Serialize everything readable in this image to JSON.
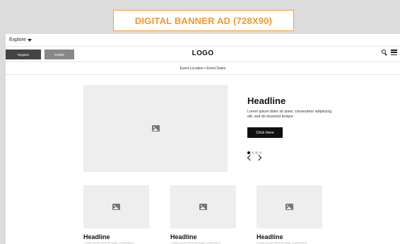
{
  "ad": {
    "label": "DIGITAL BANNER AD (728X90)"
  },
  "topbar": {
    "explore_label": "Explore"
  },
  "nav": {
    "register_label": "Register",
    "exhibit_label": "Exhibit",
    "logo_text": "LOGO"
  },
  "event_bar": {
    "text": "Event Location  •  Event Dates"
  },
  "hero": {
    "headline": "Headline",
    "body": "Lorem ipsum dolor sit amet, consectetur adipiscing elit, sed do eiusmod tempor",
    "cta_label": "Click Here",
    "slides_total": 4,
    "active_slide": 1
  },
  "cards": [
    {
      "title": "Headline",
      "body": "Lorem ipsum dolor sit amet, consectetur"
    },
    {
      "title": "Headline",
      "body": "Lorem ipsum dolor sit amet, consectetur"
    },
    {
      "title": "Headline",
      "body": "Lorem ipsum dolor sit amet, consectetur"
    }
  ],
  "icons": {
    "search": "search-icon",
    "menu": "hamburger-menu-icon",
    "image": "image-placeholder-icon",
    "prev": "chevron-left-icon",
    "next": "chevron-right-icon"
  },
  "colors": {
    "ad_accent": "#f29a2e",
    "dark_button": "#444444",
    "light_button": "#888888",
    "cta": "#111111",
    "placeholder": "#eeeeee"
  }
}
